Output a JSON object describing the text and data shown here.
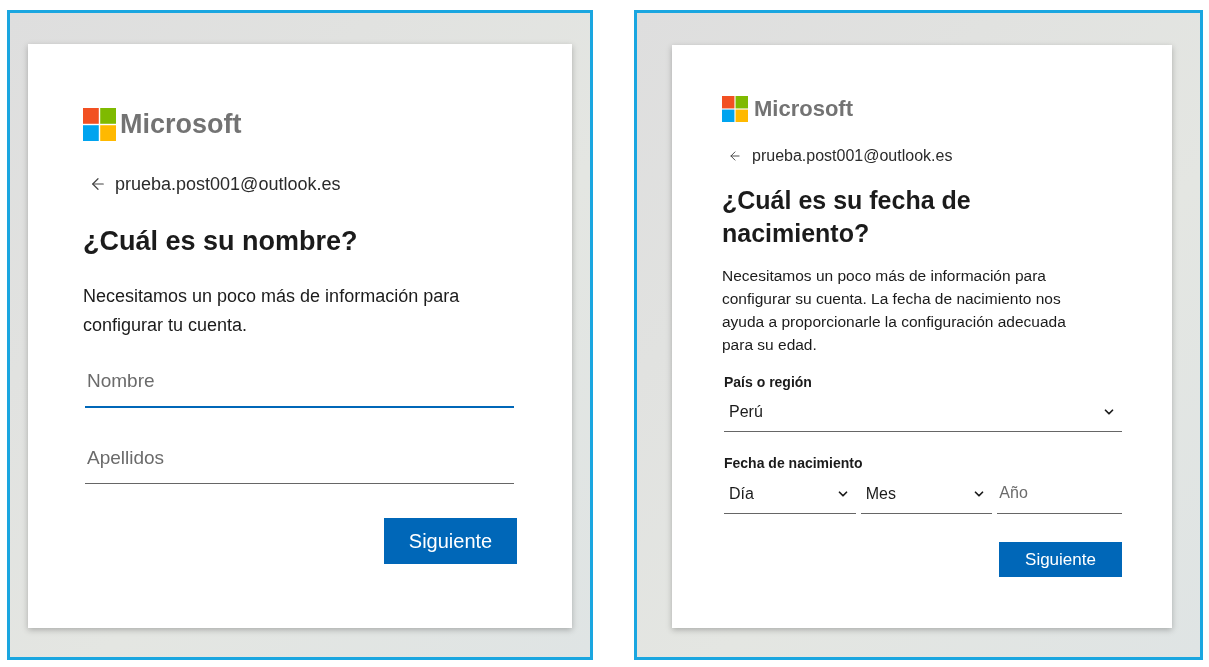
{
  "panels": [
    {
      "logo": {
        "wordmark": "Microsoft"
      },
      "account": {
        "email": "prueba.post001@outlook.es"
      },
      "title": "¿Cuál es su nombre?",
      "description": "Necesitamos un poco más de información para configurar tu cuenta.",
      "form": [
        {
          "kind": "text",
          "placeholder": "Nombre",
          "focused": true
        },
        {
          "kind": "text",
          "placeholder": "Apellidos",
          "focused": false
        }
      ],
      "button": "Siguiente"
    },
    {
      "logo": {
        "wordmark": "Microsoft"
      },
      "account": {
        "email": "prueba.post001@outlook.es"
      },
      "title": "¿Cuál es su fecha de nacimiento?",
      "description": "Necesitamos un poco más de información para configurar su cuenta. La fecha de nacimiento nos ayuda a proporcionarle la configuración adecuada para su edad.",
      "form": [
        {
          "kind": "select",
          "label": "País o región",
          "value": "Perú"
        },
        {
          "kind": "date",
          "label": "Fecha de nacimiento",
          "parts": [
            {
              "kind": "select",
              "value": "Día"
            },
            {
              "kind": "select",
              "value": "Mes"
            },
            {
              "kind": "text",
              "placeholder": "Año",
              "focused": false
            }
          ]
        }
      ],
      "button": "Siguiente"
    }
  ]
}
